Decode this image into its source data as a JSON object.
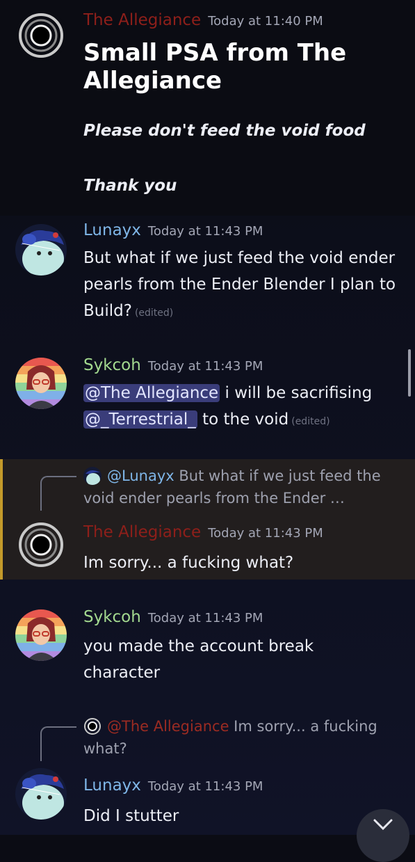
{
  "messages": [
    {
      "author": "The Allegiance",
      "time": "Today at 11:40 PM",
      "title": "Small PSA from The Allegiance",
      "lines": [
        "Please don't feed the void food",
        "Thank you"
      ]
    },
    {
      "author": "Lunayx",
      "time": "Today at 11:43 PM",
      "text": "But what if we just feed the void ender pearls from the Ender Blender I plan to Build?",
      "edited": "(edited)"
    },
    {
      "author": "Sykcoh",
      "time": "Today at 11:43 PM",
      "mention1": "@The Allegiance",
      "text1": " i will be sacrifising",
      "mention2": "@_Terrestrial_",
      "text2": " to the void",
      "edited": "(edited)"
    },
    {
      "reply_name": "@Lunayx",
      "reply_text": " But what if we just feed the void ender pearls from the Ender …",
      "author": "The Allegiance",
      "time": "Today at 11:43 PM",
      "text": "Im sorry... a fucking what?"
    },
    {
      "author": "Sykcoh",
      "time": "Today at 11:43 PM",
      "text": "you made the account break character"
    },
    {
      "reply_name": "@The Allegiance",
      "reply_text": " Im sorry... a fucking what?",
      "author": "Lunayx",
      "time": "Today at 11:43 PM",
      "text": "Did I stutter"
    }
  ],
  "colors": {
    "allegiance": "#8e1f1a",
    "lunayx": "#7fb6e8",
    "sykcoh": "#a3d98f",
    "mention_bg": "#3a3d7a",
    "highlight_border": "#c49a2a"
  },
  "icons": {
    "void": "void-avatar-icon",
    "fab": "chevron-down-icon"
  }
}
